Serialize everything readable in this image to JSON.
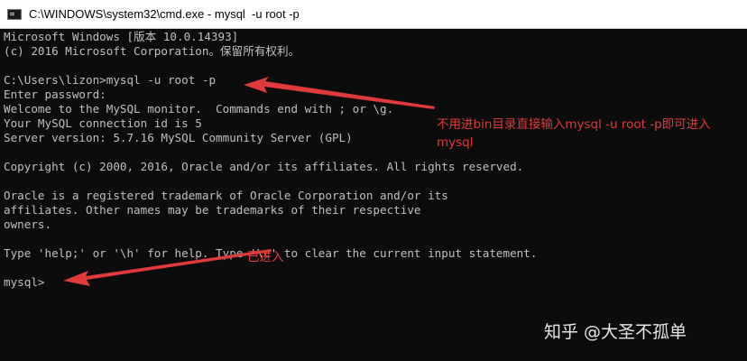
{
  "window": {
    "title": "C:\\WINDOWS\\system32\\cmd.exe - mysql  -u root -p",
    "icon": "console-app-icon"
  },
  "console": {
    "lines": [
      "Microsoft Windows [版本 10.0.14393]",
      "(c) 2016 Microsoft Corporation。保留所有权利。",
      "",
      "C:\\Users\\lizon>mysql -u root -p",
      "Enter password:",
      "Welcome to the MySQL monitor.  Commands end with ; or \\g.",
      "Your MySQL connection id is 5",
      "Server version: 5.7.16 MySQL Community Server (GPL)",
      "",
      "Copyright (c) 2000, 2016, Oracle and/or its affiliates. All rights reserved.",
      "",
      "Oracle is a registered trademark of Oracle Corporation and/or its",
      "affiliates. Other names may be trademarks of their respective",
      "owners.",
      "",
      "Type 'help;' or '\\h' for help. Type '\\c' to clear the current input statement.",
      "",
      "mysql>"
    ]
  },
  "annotations": {
    "command_note": "不用进bin目录直接输入mysql -u root -p即可进入mysql",
    "entered_note": "已进入",
    "color": "#e03a3a"
  },
  "watermark": "知乎 @大圣不孤单"
}
